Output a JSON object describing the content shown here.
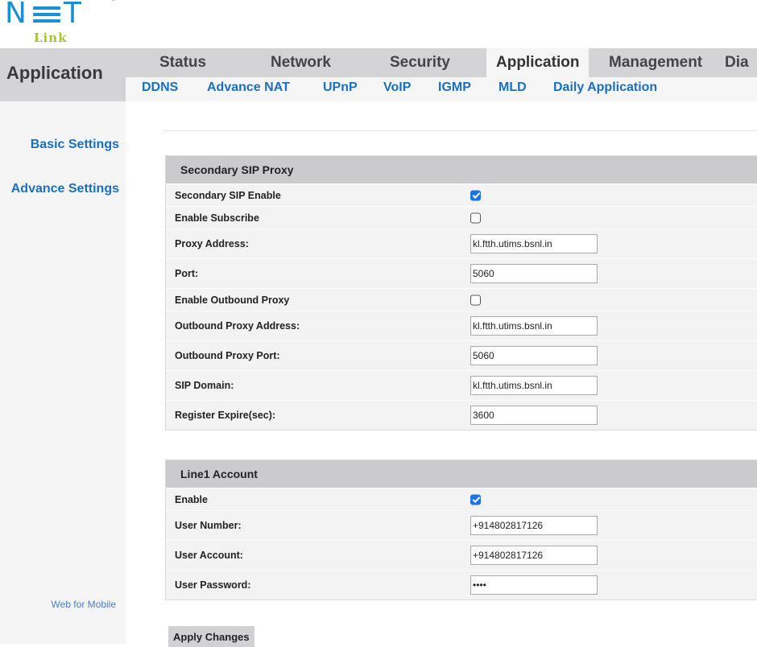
{
  "logo": {
    "brand_top": "N≡T",
    "brand_bottom": "Link",
    "registered": "®"
  },
  "header": {
    "page_heading": "Application",
    "main_tabs": [
      {
        "label": "Status"
      },
      {
        "label": "Network"
      },
      {
        "label": "Security"
      },
      {
        "label": "Application",
        "active": true
      },
      {
        "label": "Management"
      },
      {
        "label": "Dia"
      }
    ],
    "sub_tabs": [
      {
        "label": "DDNS"
      },
      {
        "label": "Advance NAT"
      },
      {
        "label": "UPnP"
      },
      {
        "label": "VoIP"
      },
      {
        "label": "IGMP"
      },
      {
        "label": "MLD"
      },
      {
        "label": "Daily Application"
      }
    ]
  },
  "sidebar": {
    "items": [
      {
        "label": "Basic Settings"
      },
      {
        "label": "Advance Settings"
      }
    ],
    "footer_link": "Web for Mobile"
  },
  "secondary_sip_proxy": {
    "title": "Secondary SIP Proxy",
    "rows": [
      {
        "label": "Secondary SIP Enable",
        "type": "checkbox",
        "checked": true
      },
      {
        "label": "Enable Subscribe",
        "type": "checkbox",
        "checked": false
      },
      {
        "label": "Proxy Address:",
        "type": "text",
        "value": "kl.ftth.utims.bsnl.in"
      },
      {
        "label": "Port:",
        "type": "text",
        "value": "5060"
      },
      {
        "label": "Enable Outbound Proxy",
        "type": "checkbox",
        "checked": false
      },
      {
        "label": "Outbound Proxy Address:",
        "type": "text",
        "value": "kl.ftth.utims.bsnl.in"
      },
      {
        "label": "Outbound Proxy Port:",
        "type": "text",
        "value": "5060"
      },
      {
        "label": "SIP Domain:",
        "type": "text",
        "value": "kl.ftth.utims.bsnl.in"
      },
      {
        "label": "Register Expire(sec):",
        "type": "text",
        "value": "3600"
      }
    ]
  },
  "line1_account": {
    "title": "Line1 Account",
    "rows": [
      {
        "label": "Enable",
        "type": "checkbox",
        "checked": true
      },
      {
        "label": "User Number:",
        "type": "text",
        "value": "+914802817126"
      },
      {
        "label": "User Account:",
        "type": "text",
        "value": "+914802817126"
      },
      {
        "label": "User Password:",
        "type": "password",
        "value": "••••"
      }
    ]
  },
  "actions": {
    "apply_label": "Apply Changes"
  },
  "colors": {
    "accent_blue": "#1a6fc0",
    "logo_blue": "#1b8fd6",
    "logo_green": "#a6c72c",
    "header_gray": "#d4d4d6",
    "checkbox_blue": "#1a73e8"
  }
}
